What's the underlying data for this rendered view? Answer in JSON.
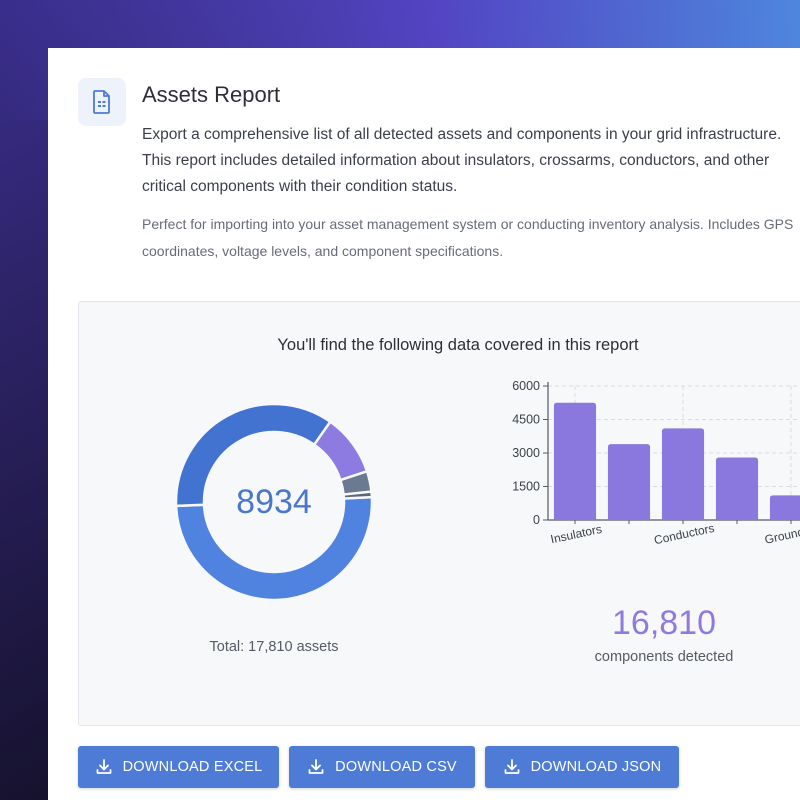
{
  "report": {
    "title": "Assets Report",
    "description": "Export a comprehensive list of all detected assets and components in your grid infrastructure. This report includes detailed information about insulators, crossarms, conductors, and other critical components with their condition status.",
    "subtext": "Perfect for importing into your asset management system or conducting inventory analysis. Includes GPS coordinates, voltage levels, and component specifications.",
    "icon": "document-icon"
  },
  "panel": {
    "title": "You'll find the following data covered in this report",
    "donut": {
      "center_value": "8934",
      "total_label": "Total: 17,810 assets"
    },
    "components": {
      "count": "16,810",
      "label": "components detected"
    }
  },
  "buttons": {
    "excel": "DOWNLOAD EXCEL",
    "csv": "DOWNLOAD CSV",
    "json": "DOWNLOAD JSON",
    "icon": "download-icon"
  },
  "colors": {
    "accent": "#4d7bd6",
    "donut_primary": "#5083e0",
    "donut_secondary": "#4373d0",
    "donut_purple": "#8d7be2",
    "donut_slate": "#6b7a90",
    "bar_purple": "#8a78de"
  },
  "chart_data": [
    {
      "type": "pie",
      "variant": "donut",
      "slices": [
        {
          "value": 8934,
          "color": "#5083e0"
        },
        {
          "value": 6300,
          "color": "#4373d0"
        },
        {
          "value": 1816,
          "color": "#8d7be2"
        },
        {
          "value": 600,
          "color": "#6b7a90"
        },
        {
          "value": 160,
          "color": "#5c6678"
        }
      ]
    },
    {
      "type": "bar",
      "categories": [
        "Insulators",
        "",
        "Conductors",
        "",
        "Grounding"
      ],
      "tick_labels": [
        "Insulators",
        "Conductors",
        "Grounding"
      ],
      "values": [
        5250,
        3400,
        4100,
        2800,
        1100
      ],
      "ylim": [
        0,
        6000
      ],
      "yticks": [
        0,
        1500,
        3000,
        4500,
        6000
      ],
      "grid": true
    }
  ]
}
